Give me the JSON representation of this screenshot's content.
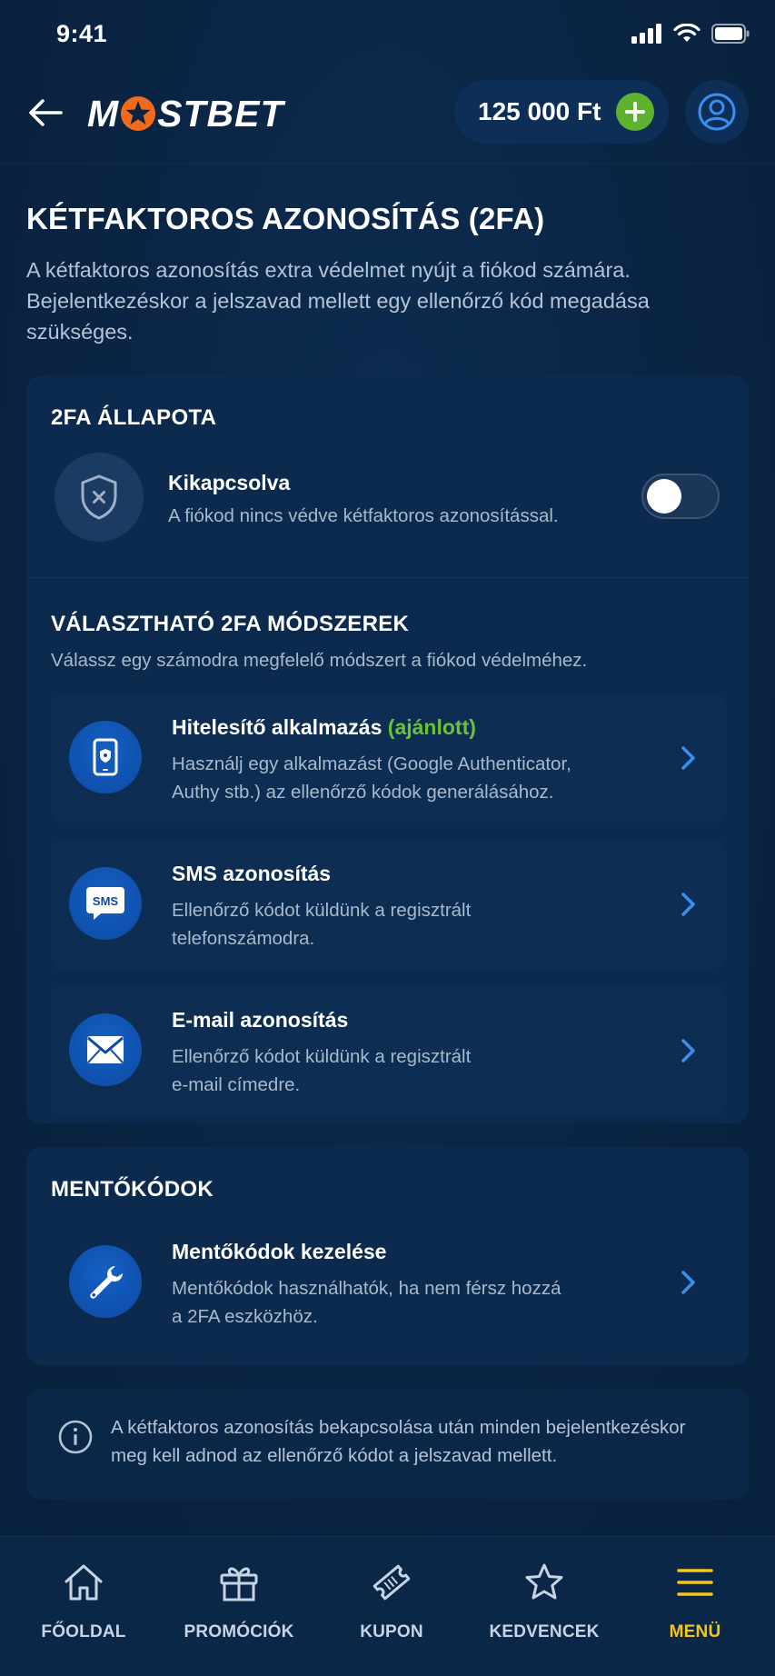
{
  "status_bar": {
    "time": "9:41"
  },
  "header": {
    "logo_text_left": "M",
    "logo_text_right": "STBET",
    "balance": "125 000 Ft"
  },
  "page": {
    "title": "KÉTFAKTOROS AZONOSÍTÁS (2FA)",
    "description": "A kétfaktoros azonosítás extra védelmet nyújt a fiókod számára. Bejelentkezéskor a jelszavad mellett egy ellenőrző kód megadása szükséges."
  },
  "status_section": {
    "title": "2FA ÁLLAPOTA",
    "state_label": "Kikapcsolva",
    "state_desc": "A fiókod nincs védve kétfaktoros azonosítással.",
    "enabled": false
  },
  "methods_section": {
    "title": "VÁLASZTHATÓ 2FA MÓDSZEREK",
    "subtitle": "Válassz egy számodra megfelelő módszert a fiókod védelméhez.",
    "methods": [
      {
        "title": "Hitelesítő alkalmazás",
        "tag": "(ajánlott)",
        "desc_line1": "Használj egy alkalmazást (Google Authenticator,",
        "desc_line2": "Authy stb.) az ellenőrző kódok generálásához.",
        "icon": "phone-lock-icon"
      },
      {
        "title": "SMS azonosítás",
        "tag": "",
        "desc_line1": "Ellenőrző kódot küldünk a regisztrált",
        "desc_line2": "telefonszámodra.",
        "icon": "sms-icon",
        "icon_text": "SMS"
      },
      {
        "title": "E-mail azonosítás",
        "tag": "",
        "desc_line1": "Ellenőrző kódot küldünk a regisztrált",
        "desc_line2": "e-mail címedre.",
        "icon": "envelope-icon"
      }
    ]
  },
  "backup_section": {
    "title": "MENTŐKÓDOK",
    "item_title": "Mentőkódok kezelése",
    "item_desc_line1": "Mentőkódok használhatók, ha nem férsz hozzá",
    "item_desc_line2": "a 2FA eszközhöz.",
    "icon": "wrench-icon"
  },
  "info_box": {
    "line1": "A kétfaktoros azonosítás bekapcsolása után minden bejelentkezéskor",
    "line2": "meg kell adnod az ellenőrző kódot a jelszavad mellett."
  },
  "bottom_nav": [
    {
      "label": "FŐOLDAL",
      "icon": "home-icon"
    },
    {
      "label": "PROMÓCIÓK",
      "icon": "gift-icon"
    },
    {
      "label": "KUPON",
      "icon": "ticket-icon"
    },
    {
      "label": "KEDVENCEK",
      "icon": "star-icon"
    },
    {
      "label": "MENÜ",
      "icon": "menu-icon",
      "active": true
    }
  ],
  "colors": {
    "background": "#0a2340",
    "card": "#0c2a4d",
    "accent_green": "#5bb32f",
    "accent_orange": "#f26b1d",
    "accent_blue": "#1560c4",
    "active_nav": "#f5c518",
    "link_blue": "#3b8ef0"
  }
}
